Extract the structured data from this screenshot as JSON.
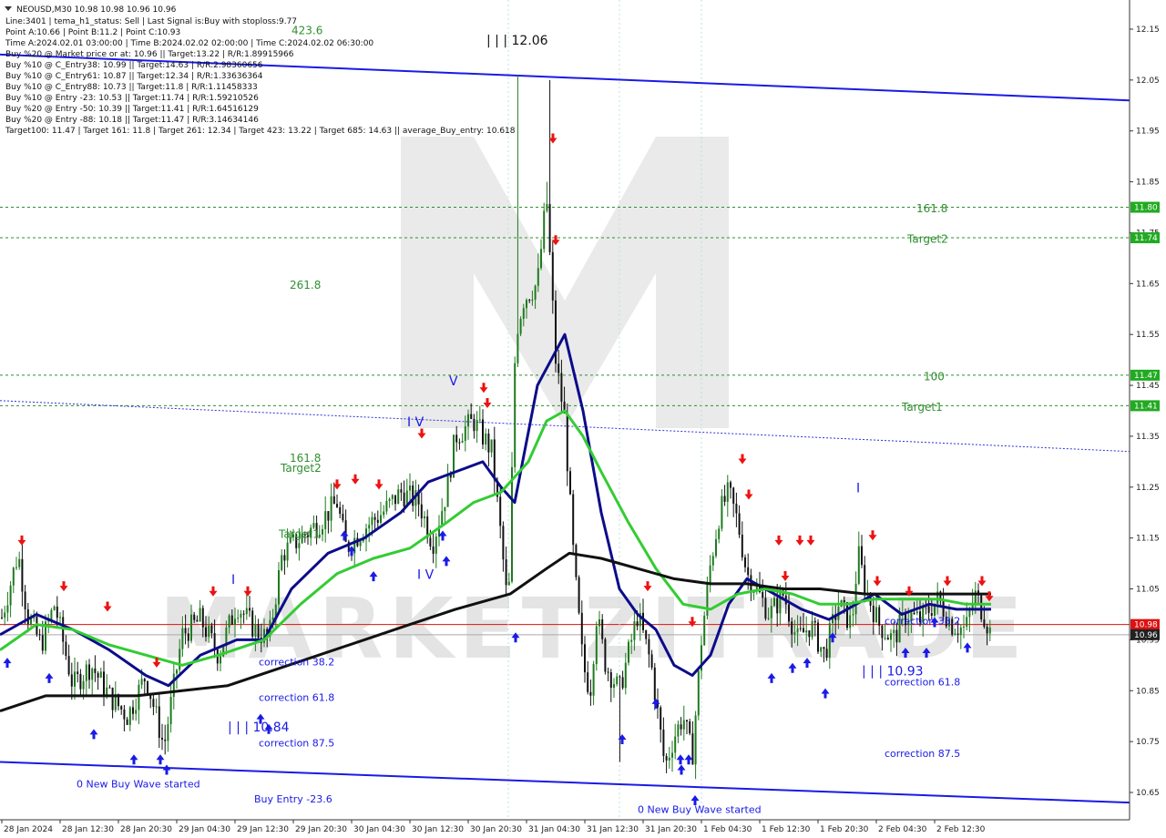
{
  "info": {
    "symbol_line": "NEOUSD,M30  10.98 10.98 10.96 10.96",
    "lines": [
      "Line:3401  |  tema_h1_status: Sell  |  Last Signal is:Buy with stoploss:9.77",
      "Point A:10.66  |  Point B:11.2  |  Point C:10.93",
      "Time A:2024.02.01 03:00:00  |  Time B:2024.02.02 02:00:00  |  Time C:2024.02.02 06:30:00",
      "Buy %20 @ Market price or at: 10.96  ||  Target:13.22  |  R/R:1.89915966",
      "Buy %10 @ C_Entry38: 10.99  ||  Target:14.63  |  R/R:2.98360656",
      "Buy %10 @ C_Entry61: 10.87  ||  Target:12.34  |  R/R:1.33636364",
      "Buy %10 @ C_Entry88: 10.73  ||  Target:11.8  |  R/R:1.11458333",
      "Buy %10 @ Entry -23: 10.53  ||  Target:11.74  |  R/R:1.59210526",
      "Buy %20 @ Entry -50: 10.39  ||  Target:11.41  |  R/R:1.64516129",
      "Buy %20 @ Entry -88: 10.18  ||  Target:11.47  |  R/R:3.14634146",
      "Target100: 11.47  |  Target 161: 11.8  |  Target 261: 12.34  |  Target 423: 13.22  |  Target 685: 14.63  ||  average_Buy_entry: 10.618"
    ]
  },
  "watermark": "MARKETZITRADE",
  "price_tags": [
    {
      "value": 11.8,
      "label": "11.80",
      "color": "#22aa22"
    },
    {
      "value": 11.74,
      "label": "11.74",
      "color": "#22aa22"
    },
    {
      "value": 11.47,
      "label": "11.47",
      "color": "#22aa22"
    },
    {
      "value": 11.41,
      "label": "11.41",
      "color": "#22aa22"
    },
    {
      "value": 10.98,
      "label": "10.98",
      "color": "#dd1111"
    },
    {
      "value": 10.96,
      "label": "10.96",
      "color": "#222222"
    }
  ],
  "chart_data": {
    "type": "candlestick",
    "symbol": "NEOUSD",
    "timeframe": "M30",
    "ylim": [
      10.61,
      12.18
    ],
    "y_ticks": [
      "12.15",
      "12.05",
      "11.95",
      "11.85",
      "11.75",
      "11.65",
      "11.55",
      "11.45",
      "11.35",
      "11.25",
      "11.15",
      "11.05",
      "10.95",
      "10.85",
      "10.75",
      "10.65"
    ],
    "x_ticks": [
      "28 Jan 2024",
      "28 Jan 12:30",
      "28 Jan 20:30",
      "29 Jan 04:30",
      "29 Jan 12:30",
      "29 Jan 20:30",
      "30 Jan 04:30",
      "30 Jan 12:30",
      "30 Jan 20:30",
      "31 Jan 04:30",
      "31 Jan 12:30",
      "31 Jan 20:30",
      "1 Feb 04:30",
      "1 Feb 12:30",
      "1 Feb 20:30",
      "2 Feb 04:30",
      "2 Feb 12:30"
    ],
    "grid": false,
    "close_path": [
      [
        0,
        10.98
      ],
      [
        10,
        11.05
      ],
      [
        20,
        11.12
      ],
      [
        30,
        11.0
      ],
      [
        45,
        10.94
      ],
      [
        60,
        11.02
      ],
      [
        80,
        10.86
      ],
      [
        100,
        10.9
      ],
      [
        120,
        10.84
      ],
      [
        140,
        10.8
      ],
      [
        160,
        10.88
      ],
      [
        180,
        10.74
      ],
      [
        200,
        10.96
      ],
      [
        220,
        10.99
      ],
      [
        240,
        10.92
      ],
      [
        260,
        11.02
      ],
      [
        280,
        10.97
      ],
      [
        295,
        10.95
      ],
      [
        310,
        11.12
      ],
      [
        330,
        11.15
      ],
      [
        350,
        11.18
      ],
      [
        370,
        11.22
      ],
      [
        380,
        11.13
      ],
      [
        400,
        11.17
      ],
      [
        420,
        11.2
      ],
      [
        440,
        11.24
      ],
      [
        460,
        11.22
      ],
      [
        475,
        11.14
      ],
      [
        490,
        11.24
      ],
      [
        500,
        11.35
      ],
      [
        520,
        11.38
      ],
      [
        540,
        11.32
      ],
      [
        550,
        11.15
      ],
      [
        558,
        11.0
      ],
      [
        566,
        11.55
      ],
      [
        575,
        11.62
      ],
      [
        590,
        11.65
      ],
      [
        600,
        11.82
      ],
      [
        610,
        11.5
      ],
      [
        620,
        11.38
      ],
      [
        630,
        11.1
      ],
      [
        640,
        10.9
      ],
      [
        648,
        10.85
      ],
      [
        655,
        11.0
      ],
      [
        665,
        10.9
      ],
      [
        680,
        10.85
      ],
      [
        700,
        11.0
      ],
      [
        715,
        10.9
      ],
      [
        730,
        10.7
      ],
      [
        740,
        10.76
      ],
      [
        750,
        10.8
      ],
      [
        760,
        10.72
      ],
      [
        770,
        10.95
      ],
      [
        780,
        11.1
      ],
      [
        790,
        11.2
      ],
      [
        800,
        11.24
      ],
      [
        810,
        11.18
      ],
      [
        820,
        11.08
      ],
      [
        830,
        11.05
      ],
      [
        845,
        11.0
      ],
      [
        860,
        11.04
      ],
      [
        875,
        10.95
      ],
      [
        890,
        10.98
      ],
      [
        905,
        10.92
      ],
      [
        920,
        11.02
      ],
      [
        935,
        10.98
      ],
      [
        942,
        11.12
      ],
      [
        950,
        11.05
      ],
      [
        965,
        10.98
      ],
      [
        980,
        10.95
      ],
      [
        995,
        11.0
      ],
      [
        1010,
        10.99
      ],
      [
        1030,
        11.03
      ],
      [
        1045,
        10.98
      ],
      [
        1060,
        10.97
      ],
      [
        1070,
        11.04
      ],
      [
        1080,
        11.0
      ],
      [
        1088,
        10.96
      ]
    ],
    "series": [
      {
        "kind": "line",
        "color": "#0c0c8a",
        "points": [
          [
            0,
            10.96
          ],
          [
            40,
            11.0
          ],
          [
            80,
            10.97
          ],
          [
            120,
            10.93
          ],
          [
            160,
            10.88
          ],
          [
            185,
            10.86
          ],
          [
            220,
            10.92
          ],
          [
            260,
            10.95
          ],
          [
            290,
            10.95
          ],
          [
            320,
            11.05
          ],
          [
            360,
            11.12
          ],
          [
            400,
            11.15
          ],
          [
            440,
            11.2
          ],
          [
            470,
            11.26
          ],
          [
            500,
            11.28
          ],
          [
            530,
            11.3
          ],
          [
            550,
            11.25
          ],
          [
            565,
            11.22
          ],
          [
            590,
            11.45
          ],
          [
            620,
            11.55
          ],
          [
            640,
            11.4
          ],
          [
            660,
            11.2
          ],
          [
            680,
            11.05
          ],
          [
            700,
            11.0
          ],
          [
            720,
            10.97
          ],
          [
            740,
            10.9
          ],
          [
            760,
            10.88
          ],
          [
            780,
            10.92
          ],
          [
            800,
            11.02
          ],
          [
            820,
            11.07
          ],
          [
            850,
            11.04
          ],
          [
            880,
            11.01
          ],
          [
            910,
            10.99
          ],
          [
            940,
            11.02
          ],
          [
            960,
            11.04
          ],
          [
            990,
            11.0
          ],
          [
            1020,
            11.02
          ],
          [
            1050,
            11.01
          ],
          [
            1088,
            11.01
          ]
        ]
      },
      {
        "kind": "line",
        "color": "#33cc33",
        "points": [
          [
            0,
            10.93
          ],
          [
            40,
            10.98
          ],
          [
            80,
            10.97
          ],
          [
            120,
            10.94
          ],
          [
            160,
            10.92
          ],
          [
            200,
            10.9
          ],
          [
            240,
            10.92
          ],
          [
            290,
            10.95
          ],
          [
            330,
            11.02
          ],
          [
            370,
            11.08
          ],
          [
            410,
            11.11
          ],
          [
            450,
            11.13
          ],
          [
            490,
            11.18
          ],
          [
            520,
            11.22
          ],
          [
            550,
            11.24
          ],
          [
            580,
            11.3
          ],
          [
            600,
            11.38
          ],
          [
            620,
            11.4
          ],
          [
            640,
            11.35
          ],
          [
            660,
            11.28
          ],
          [
            690,
            11.18
          ],
          [
            720,
            11.09
          ],
          [
            750,
            11.02
          ],
          [
            780,
            11.01
          ],
          [
            810,
            11.04
          ],
          [
            840,
            11.05
          ],
          [
            870,
            11.04
          ],
          [
            900,
            11.02
          ],
          [
            930,
            11.02
          ],
          [
            960,
            11.03
          ],
          [
            990,
            11.03
          ],
          [
            1030,
            11.03
          ],
          [
            1060,
            11.02
          ],
          [
            1088,
            11.02
          ]
        ]
      },
      {
        "kind": "line",
        "color": "#111111",
        "points": [
          [
            0,
            10.81
          ],
          [
            50,
            10.84
          ],
          [
            100,
            10.84
          ],
          [
            150,
            10.84
          ],
          [
            200,
            10.85
          ],
          [
            250,
            10.86
          ],
          [
            300,
            10.89
          ],
          [
            350,
            10.92
          ],
          [
            400,
            10.95
          ],
          [
            450,
            10.98
          ],
          [
            500,
            11.01
          ],
          [
            560,
            11.04
          ],
          [
            600,
            11.09
          ],
          [
            625,
            11.12
          ],
          [
            660,
            11.11
          ],
          [
            700,
            11.09
          ],
          [
            740,
            11.07
          ],
          [
            780,
            11.06
          ],
          [
            820,
            11.06
          ],
          [
            860,
            11.05
          ],
          [
            900,
            11.05
          ],
          [
            950,
            11.04
          ],
          [
            1000,
            11.04
          ],
          [
            1050,
            11.04
          ],
          [
            1088,
            11.04
          ]
        ]
      }
    ],
    "channel": [
      {
        "name": "upper",
        "color": "#1a1ae6",
        "from": [
          0,
          12.1
        ],
        "to": [
          1240,
          12.01
        ]
      },
      {
        "name": "lower",
        "color": "#1a1ae6",
        "from": [
          0,
          10.71
        ],
        "to": [
          1240,
          10.63
        ]
      },
      {
        "name": "mid",
        "color": "#3030e0",
        "style": "dotted",
        "from": [
          0,
          11.42
        ],
        "to": [
          1240,
          11.32
        ]
      }
    ],
    "levels": [
      {
        "value": 11.8,
        "color": "#2f8f2f"
      },
      {
        "value": 11.74,
        "color": "#2f8f2f"
      },
      {
        "value": 11.47,
        "color": "#2f8f2f"
      },
      {
        "value": 11.41,
        "color": "#2f8f2f"
      },
      {
        "value": 10.98,
        "color": "#dd1111",
        "style": "solid"
      },
      {
        "value": 10.96,
        "color": "#aaaaaa",
        "style": "solid"
      }
    ],
    "annotations": [
      {
        "text": "423.6",
        "cls": "lvl-text",
        "x": 320,
        "price": 12.14
      },
      {
        "text": "261.8",
        "cls": "lvl-text",
        "x": 318,
        "price": 11.64
      },
      {
        "text": "161.8",
        "cls": "lvl-text",
        "x": 318,
        "price": 11.3
      },
      {
        "text": "Target2",
        "cls": "lvl-text",
        "x": 308,
        "price": 11.28
      },
      {
        "text": "Target1",
        "cls": "lvl-text",
        "x": 306,
        "price": 11.15
      },
      {
        "text": "161.8",
        "cls": "lvl-text",
        "x": 1006,
        "price": 11.79
      },
      {
        "text": "Target2",
        "cls": "lvl-text",
        "x": 996,
        "price": 11.73
      },
      {
        "text": "100",
        "cls": "lvl-text",
        "x": 1014,
        "price": 11.46
      },
      {
        "text": "Target1",
        "cls": "lvl-text",
        "x": 990,
        "price": 11.4
      },
      {
        "text": "| | | 12.06",
        "cls": "black-text",
        "x": 534,
        "price": 12.12
      },
      {
        "text": "V",
        "cls": "wave-text",
        "x": 493,
        "price": 11.45
      },
      {
        "text": "I V",
        "cls": "wave-text",
        "x": 447,
        "price": 11.37
      },
      {
        "text": "I V",
        "cls": "wave-text",
        "x": 458,
        "price": 11.07
      },
      {
        "text": "I",
        "cls": "wave-text",
        "x": 254,
        "price": 11.06
      },
      {
        "text": "| | | 10.84",
        "cls": "wave-text",
        "x": 250,
        "price": 10.77
      },
      {
        "text": "I",
        "cls": "wave-text",
        "x": 940,
        "price": 11.24
      },
      {
        "text": "| | | 10.93",
        "cls": "wave-text",
        "x": 946,
        "price": 10.88
      },
      {
        "text": "correction 38.2",
        "cls": "blue-text",
        "x": 284,
        "price": 10.9
      },
      {
        "text": "correction 61.8",
        "cls": "blue-text",
        "x": 284,
        "price": 10.83
      },
      {
        "text": "correction 87.5",
        "cls": "blue-text",
        "x": 284,
        "price": 10.74
      },
      {
        "text": "0 New Buy Wave started",
        "cls": "blue-text",
        "x": 84,
        "price": 10.66
      },
      {
        "text": "Buy Entry -23.6",
        "cls": "blue-text",
        "x": 279,
        "price": 10.63
      },
      {
        "text": "correction 38.2",
        "cls": "blue-text",
        "x": 971,
        "price": 10.98
      },
      {
        "text": "correction 61.8",
        "cls": "blue-text",
        "x": 971,
        "price": 10.86
      },
      {
        "text": "correction 87.5",
        "cls": "blue-text",
        "x": 971,
        "price": 10.72
      },
      {
        "text": "0 New Buy Wave started",
        "cls": "blue-text",
        "x": 700,
        "price": 10.61
      }
    ],
    "sell_arrows": [
      [
        24,
        11.13
      ],
      [
        70,
        11.04
      ],
      [
        118,
        11.0
      ],
      [
        172,
        10.89
      ],
      [
        234,
        11.03
      ],
      [
        272,
        11.03
      ],
      [
        370,
        11.24
      ],
      [
        390,
        11.25
      ],
      [
        416,
        11.24
      ],
      [
        463,
        11.34
      ],
      [
        531,
        11.43
      ],
      [
        535,
        11.4
      ],
      [
        607,
        11.92
      ],
      [
        610,
        11.72
      ],
      [
        711,
        11.04
      ],
      [
        760,
        10.97
      ],
      [
        815,
        11.29
      ],
      [
        822,
        11.22
      ],
      [
        855,
        11.13
      ],
      [
        862,
        11.06
      ],
      [
        878,
        11.13
      ],
      [
        890,
        11.13
      ],
      [
        958,
        11.14
      ],
      [
        963,
        11.05
      ],
      [
        998,
        11.03
      ],
      [
        1040,
        11.05
      ],
      [
        1078,
        11.05
      ],
      [
        1086,
        11.02
      ]
    ],
    "buy_arrows": [
      [
        8,
        10.92
      ],
      [
        54,
        10.89
      ],
      [
        103,
        10.78
      ],
      [
        147,
        10.73
      ],
      [
        176,
        10.73
      ],
      [
        183,
        10.71
      ],
      [
        286,
        10.81
      ],
      [
        295,
        10.79
      ],
      [
        378,
        11.17
      ],
      [
        386,
        11.14
      ],
      [
        410,
        11.09
      ],
      [
        486,
        11.17
      ],
      [
        490,
        11.12
      ],
      [
        566,
        10.97
      ],
      [
        683,
        10.77
      ],
      [
        720,
        10.84
      ],
      [
        747,
        10.73
      ],
      [
        748,
        10.71
      ],
      [
        756,
        10.73
      ],
      [
        763,
        10.65
      ],
      [
        847,
        10.89
      ],
      [
        870,
        10.91
      ],
      [
        886,
        10.92
      ],
      [
        906,
        10.86
      ],
      [
        914,
        10.97
      ],
      [
        994,
        10.94
      ],
      [
        1017,
        10.94
      ],
      [
        1026,
        11.0
      ],
      [
        1062,
        10.95
      ]
    ]
  }
}
